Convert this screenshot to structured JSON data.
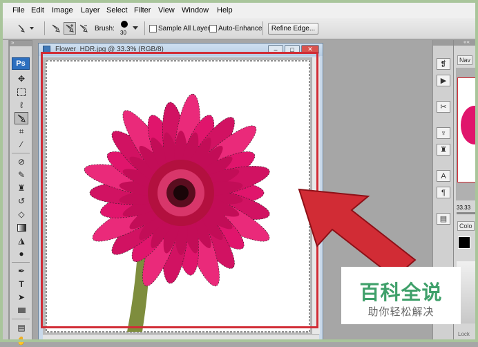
{
  "menu": [
    "File",
    "Edit",
    "Image",
    "Layer",
    "Select",
    "Filter",
    "View",
    "Window",
    "Help"
  ],
  "options_bar": {
    "brush_label": "Brush:",
    "brush_size": "30",
    "sample_all_layers": "Sample All Layers",
    "auto_enhance": "Auto-Enhance",
    "refine_edge": "Refine Edge..."
  },
  "toolbox": {
    "logo": "Ps",
    "tools": [
      "move-tool",
      "marquee-tool",
      "lasso-tool",
      "quick-selection-tool",
      "crop-tool",
      "eyedropper-tool",
      "healing-brush-tool",
      "brush-tool",
      "clone-stamp-tool",
      "history-brush-tool",
      "eraser-tool",
      "gradient-tool",
      "blur-tool",
      "dodge-tool",
      "pen-tool",
      "type-tool",
      "path-selection-tool",
      "shape-tool",
      "notes-tool",
      "hand-tool"
    ]
  },
  "document": {
    "title": "Flower_HDR.jpg @ 33.3% (RGB/8)"
  },
  "nav_panel": {
    "tab": "Nav",
    "zoom": "33.33",
    "color_tab": "Colo",
    "lock_label": "Lock"
  },
  "watermark": {
    "main": "百科全说",
    "sub": "助你轻松解决"
  },
  "colors": {
    "annotation_red": "#d12c35",
    "flower": "#e0156c",
    "watermark_green": "#3fa06a"
  }
}
